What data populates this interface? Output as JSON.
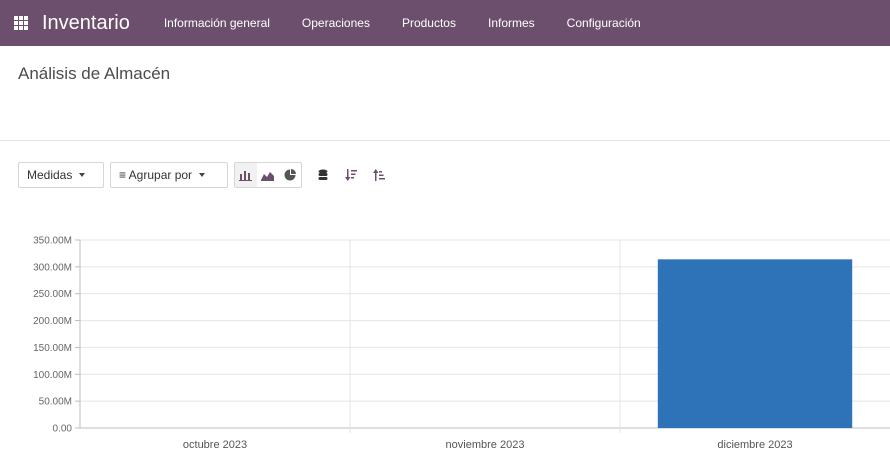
{
  "navbar": {
    "app_title": "Inventario",
    "menu": [
      "Información general",
      "Operaciones",
      "Productos",
      "Informes",
      "Configuración"
    ]
  },
  "page": {
    "title": "Análisis de Almacén"
  },
  "toolbar": {
    "measures_label": "Medidas",
    "group_by_label": "≡ Agrupar por",
    "icons": [
      "bar-chart-icon",
      "line-chart-icon",
      "pie-chart-icon",
      "stack-icon",
      "sort-descending-icon",
      "sort-ascending-icon"
    ]
  },
  "colors": {
    "navbar": "#6c4f6d",
    "bar": "#2e72b8",
    "active_icon": "#6c4f6d"
  },
  "chart_data": {
    "type": "bar",
    "categories": [
      "octubre 2023",
      "noviembre 2023",
      "diciembre 2023"
    ],
    "values": [
      0,
      0,
      314000000
    ],
    "y_ticks": [
      "0.00",
      "50.00M",
      "100.00M",
      "150.00M",
      "200.00M",
      "250.00M",
      "300.00M",
      "350.00M"
    ],
    "ylim": [
      0,
      350000000
    ],
    "grid": true
  }
}
